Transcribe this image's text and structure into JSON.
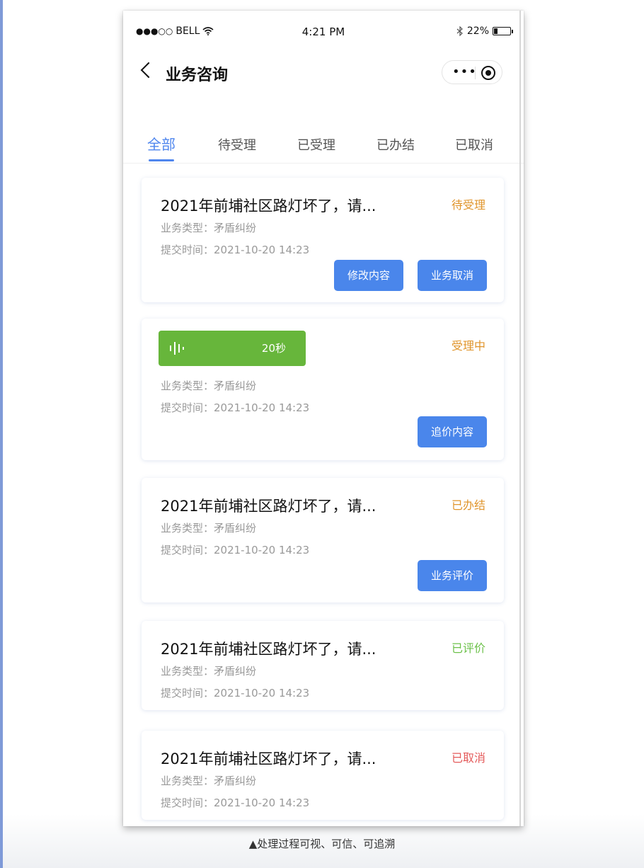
{
  "status_bar": {
    "carrier": "BELL",
    "time": "4:21 PM",
    "battery": "22%",
    "battery_level": 0.22,
    "signal_icon": "signal-dots-icon",
    "wifi_icon": "wifi-icon",
    "bluetooth_icon": "bluetooth-icon"
  },
  "nav": {
    "title": "业务咨询",
    "back_icon": "chevron-left-icon",
    "more_icon": "more-icon",
    "close_icon": "target-icon"
  },
  "tabs": [
    {
      "label": "全部",
      "active": true
    },
    {
      "label": "待受理",
      "active": false
    },
    {
      "label": "已受理",
      "active": false
    },
    {
      "label": "已办结",
      "active": false
    },
    {
      "label": "已取消",
      "active": false
    }
  ],
  "colors": {
    "accent": "#4f86ee",
    "button": "#4a86eb",
    "status_pending": "#e0952c",
    "status_rated": "#6cc14a",
    "status_cancelled": "#e45a5a",
    "voice": "#67b63b"
  },
  "cards": [
    {
      "title": "2021年前埔社区路灯坏了，请...",
      "status": "待受理",
      "type": "业务类型：矛盾纠纷",
      "time": "提交时间：2021-10-20 14:23",
      "buttons": [
        "修改内容",
        "业务取消"
      ]
    },
    {
      "voice_duration": "20秒",
      "voice_icon": "voice-wave-icon",
      "status": "受理中",
      "type": "业务类型：矛盾纠纷",
      "time": "提交时间：2021-10-20 14:23",
      "buttons": [
        "追价内容"
      ]
    },
    {
      "title": "2021年前埔社区路灯坏了，请...",
      "status": "已办结",
      "type": "业务类型：矛盾纠纷",
      "time": "提交时间：2021-10-20 14:23",
      "buttons": [
        "业务评价"
      ]
    },
    {
      "title": "2021年前埔社区路灯坏了，请...",
      "status": "已评价",
      "type": "业务类型：矛盾纠纷",
      "time": "提交时间：2021-10-20 14:23",
      "buttons": []
    },
    {
      "title": "2021年前埔社区路灯坏了，请...",
      "status": "已取消",
      "type": "业务类型：矛盾纠纷",
      "time": "提交时间：2021-10-20 14:23",
      "buttons": []
    }
  ],
  "caption": "▲处理过程可视、可信、可追溯"
}
